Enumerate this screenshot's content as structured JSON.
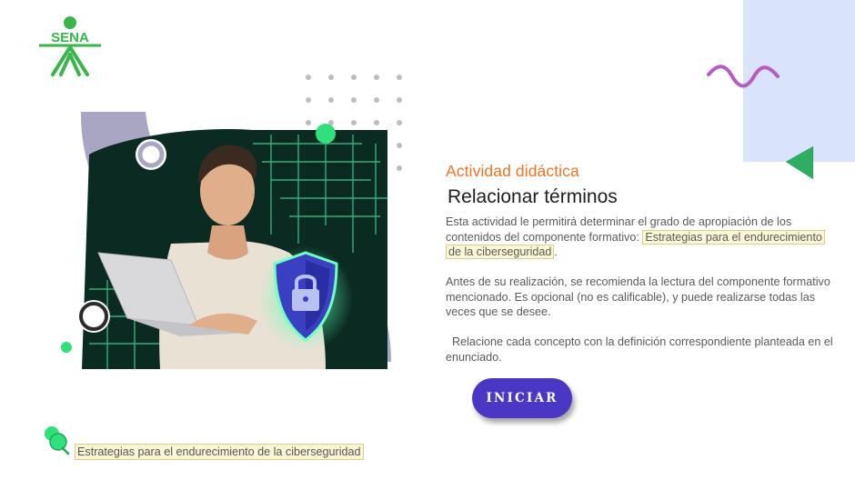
{
  "logo": {
    "text": "SENA"
  },
  "activity": {
    "label": "Actividad didáctica",
    "title": "Relacionar términos",
    "paragraph_1_prefix": "Esta actividad le permitirá determinar el grado de apropiación de los contenidos del componente formativo: ",
    "paragraph_1_highlight": "Estrategias para el endurecimiento de la ciberseguridad",
    "paragraph_1_suffix": ".",
    "paragraph_2": "Antes de su realización, se recomienda la lectura del componente formativo mencionado.  Es opcional (no es calificable), y puede realizarse todas las veces que se desee.",
    "paragraph_3": "  Relacione cada concepto con la definición correspondiente planteada en el enunciado."
  },
  "start_button": {
    "label": "INICIAR"
  },
  "footer": {
    "component_name": "Estrategias para el endurecimiento de la ciberseguridad"
  },
  "colors": {
    "accent_orange": "#ee7422",
    "button_purple": "#4a37c4",
    "logo_green": "#39b54a",
    "highlight_bg": "#fbf7d6",
    "panel_blue": "#d9e3fb",
    "wave_purple": "#c060c8",
    "triangle_green": "#3dbf6e"
  },
  "icons": {
    "deco_wave": "wave-squiggle",
    "deco_triangle": "triangle-left",
    "hero": "person-laptop-shield-lock",
    "bottom": "green-pushpin"
  }
}
